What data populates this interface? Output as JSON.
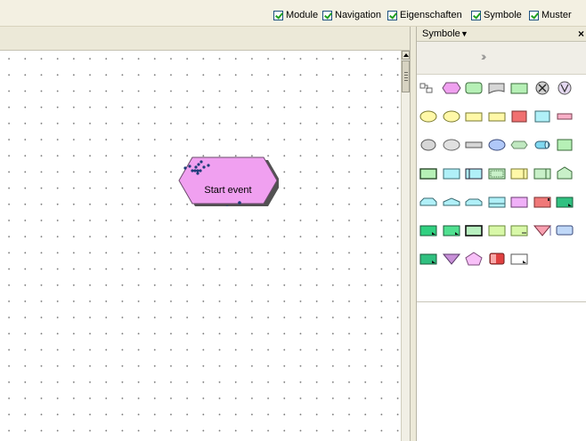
{
  "toolbar": {
    "checkboxes": [
      {
        "label": "Module",
        "checked": true
      },
      {
        "label": "Navigation",
        "checked": true
      },
      {
        "label": "Eigenschaften",
        "checked": true
      },
      {
        "label": "Symbole",
        "checked": true
      },
      {
        "label": "Muster",
        "checked": true
      }
    ]
  },
  "canvas": {
    "start_event": {
      "label": "Start event",
      "fill": "#f0a0f0",
      "stroke": "#6b4b6b"
    }
  },
  "symbols_panel": {
    "title": "Symbole",
    "dropdown_icon": "▼",
    "close_icon": "×",
    "expand_icon": "»",
    "symbols": [
      [
        "connector",
        "pink-hexagon",
        "green-rounded",
        "gray-document",
        "green-rect",
        "gray-x-circle",
        "violet-v-circle"
      ],
      [
        "yellow-ellipse",
        "yellow-ellipse-2",
        "yellow-rect",
        "yellow-rect-2",
        "red-rect",
        "cyan-rect",
        "pink-rect-small"
      ],
      [
        "gray-oval",
        "gray-oval-2",
        "gray-slim-rect",
        "blue-cloud",
        "green-hexagon-small",
        "cyan-cylinder",
        "green-rect-2"
      ],
      [
        "green-rect-3",
        "cyan-rect-2",
        "cyan-column-rect",
        "green-grid-rect",
        "yellow-column-rect",
        "green-column-rect",
        "green-house"
      ],
      [
        "cyan-trapezoid",
        "cyan-trapezoid-2",
        "cyan-trapezoid-3",
        "cyan-rect-3",
        "violet-rect",
        "red-rect-2",
        "teal-rect-corner"
      ],
      [
        "teal-rect-corner-2",
        "green-rect-corner",
        "dark-rect",
        "lime-rect",
        "lime-rect-small",
        "red-triangle",
        "blue-rect"
      ],
      [
        "teal-rect-corner-3",
        "violet-triangle",
        "pink-pentagon",
        "red-gradient-rect",
        "white-rect"
      ]
    ]
  }
}
